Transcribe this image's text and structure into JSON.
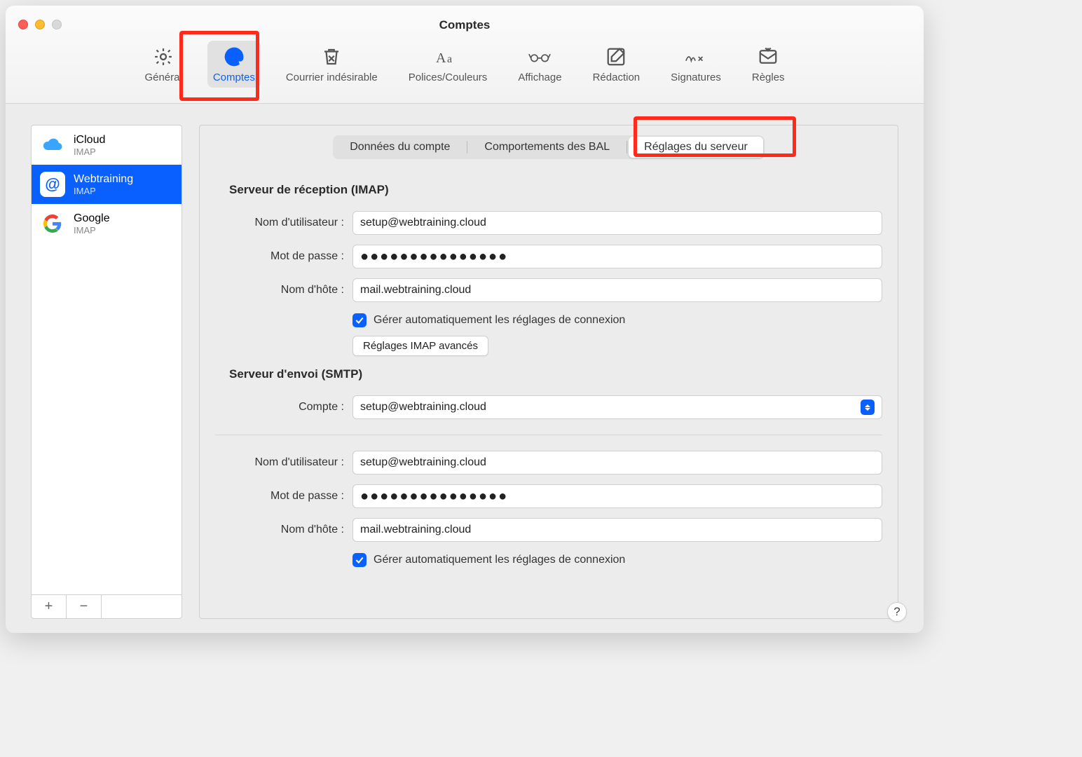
{
  "window_title": "Comptes",
  "toolbar": [
    {
      "key": "general",
      "label": "Général"
    },
    {
      "key": "accounts",
      "label": "Comptes"
    },
    {
      "key": "junk",
      "label": "Courrier indésirable"
    },
    {
      "key": "fonts",
      "label": "Polices/Couleurs"
    },
    {
      "key": "viewing",
      "label": "Affichage"
    },
    {
      "key": "composing",
      "label": "Rédaction"
    },
    {
      "key": "signatures",
      "label": "Signatures"
    },
    {
      "key": "rules",
      "label": "Règles"
    }
  ],
  "toolbar_active_key": "accounts",
  "sidebar": {
    "accounts": [
      {
        "name": "iCloud",
        "protocol": "IMAP",
        "icon": "icloud"
      },
      {
        "name": "Webtraining",
        "protocol": "IMAP",
        "icon": "at"
      },
      {
        "name": "Google",
        "protocol": "IMAP",
        "icon": "google"
      }
    ],
    "selected_index": 1,
    "add_label": "+",
    "remove_label": "−"
  },
  "tabs": {
    "items": [
      {
        "key": "info",
        "label": "Données du compte"
      },
      {
        "key": "behavior",
        "label": "Comportements des BAL"
      },
      {
        "key": "server",
        "label": "Réglages du serveur"
      }
    ],
    "active_key": "server"
  },
  "incoming": {
    "section_title": "Serveur de réception (IMAP)",
    "username_label": "Nom d'utilisateur :",
    "username_value": "setup@webtraining.cloud",
    "password_label": "Mot de passe :",
    "password_value": "●●●●●●●●●●●●●●●",
    "host_label": "Nom d'hôte :",
    "host_value": "mail.webtraining.cloud",
    "auto_manage_label": "Gérer automatiquement les réglages de connexion",
    "auto_manage_checked": true,
    "advanced_button_label": "Réglages IMAP avancés"
  },
  "outgoing": {
    "section_title": "Serveur d'envoi (SMTP)",
    "account_label": "Compte :",
    "account_value": "setup@webtraining.cloud",
    "username_label": "Nom d'utilisateur :",
    "username_value": "setup@webtraining.cloud",
    "password_label": "Mot de passe :",
    "password_value": "●●●●●●●●●●●●●●●",
    "host_label": "Nom d'hôte :",
    "host_value": "mail.webtraining.cloud",
    "auto_manage_label": "Gérer automatiquement les réglages de connexion",
    "auto_manage_checked": true
  },
  "help_label": "?"
}
